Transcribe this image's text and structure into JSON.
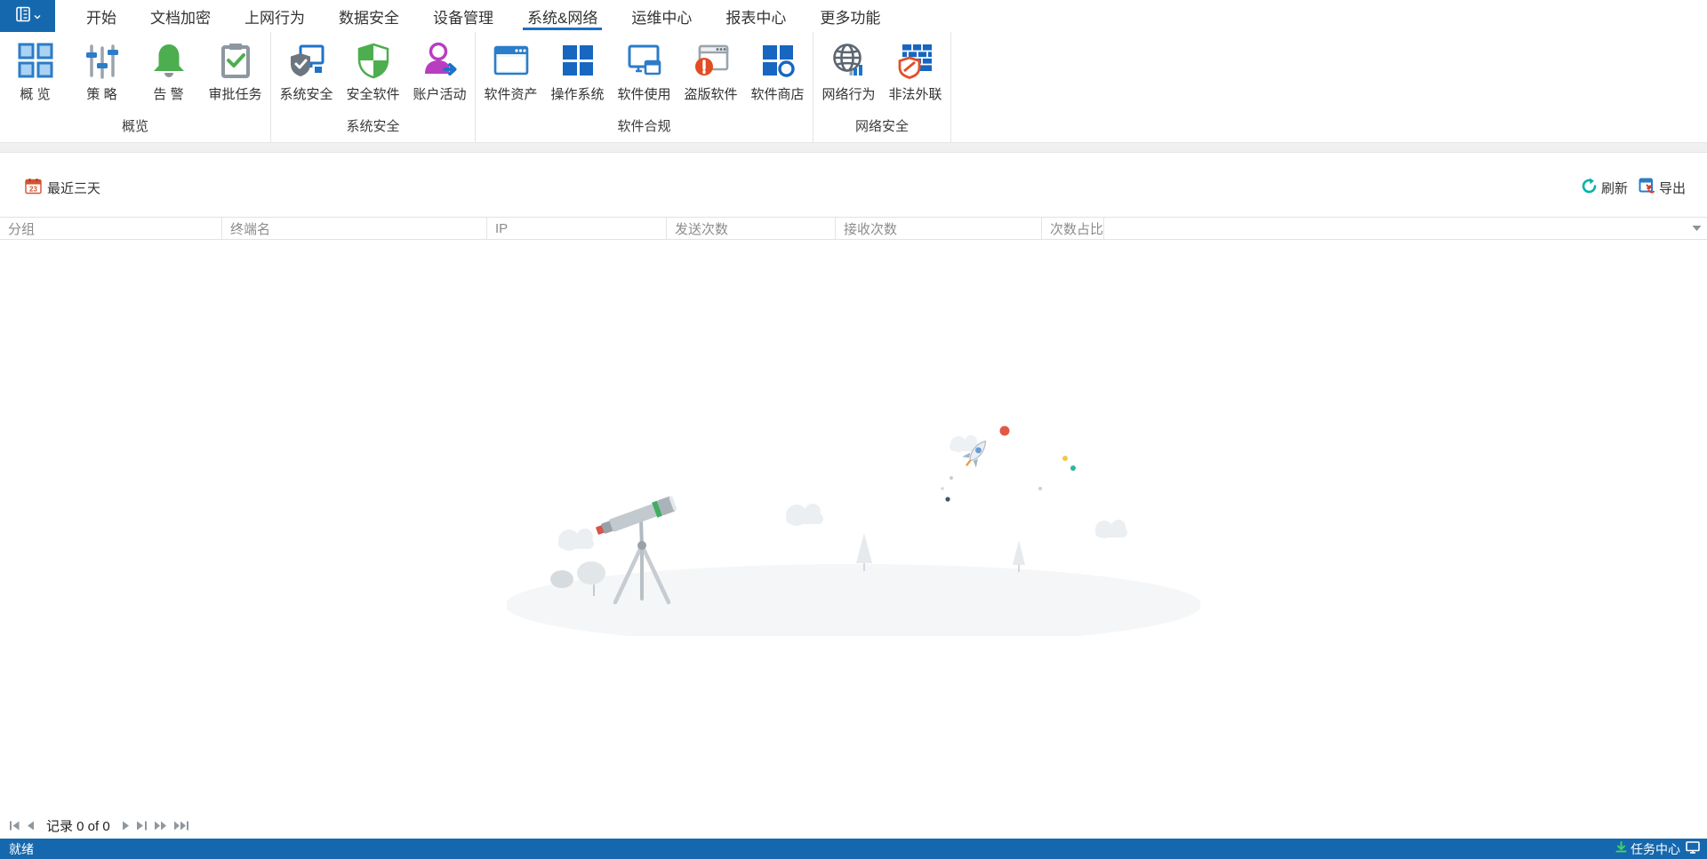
{
  "app": {
    "tabs": [
      {
        "label": "开始",
        "selected": false
      },
      {
        "label": "文档加密",
        "selected": false
      },
      {
        "label": "上网行为",
        "selected": false
      },
      {
        "label": "数据安全",
        "selected": false
      },
      {
        "label": "设备管理",
        "selected": false
      },
      {
        "label": "系统&网络",
        "selected": true
      },
      {
        "label": "运维中心",
        "selected": false
      },
      {
        "label": "报表中心",
        "selected": false
      },
      {
        "label": "更多功能",
        "selected": false
      }
    ]
  },
  "ribbon": {
    "groups": [
      {
        "label": "概览",
        "items": [
          {
            "label": "概 览",
            "icon": "overview-grid-icon"
          },
          {
            "label": "策 略",
            "icon": "policy-sliders-icon"
          },
          {
            "label": "告 警",
            "icon": "alert-bell-icon"
          },
          {
            "label": "审批任务",
            "icon": "approval-clipboard-icon"
          }
        ]
      },
      {
        "label": "系统安全",
        "items": [
          {
            "label": "系统安全",
            "icon": "system-security-icon"
          },
          {
            "label": "安全软件",
            "icon": "security-software-icon"
          },
          {
            "label": "账户活动",
            "icon": "account-activity-icon"
          }
        ]
      },
      {
        "label": "软件合规",
        "items": [
          {
            "label": "软件资产",
            "icon": "software-asset-icon"
          },
          {
            "label": "操作系统",
            "icon": "os-windows-icon"
          },
          {
            "label": "软件使用",
            "icon": "software-usage-icon"
          },
          {
            "label": "盗版软件",
            "icon": "pirated-software-icon"
          },
          {
            "label": "软件商店",
            "icon": "software-store-icon"
          }
        ]
      },
      {
        "label": "网络安全",
        "items": [
          {
            "label": "网络行为",
            "icon": "network-behavior-icon"
          },
          {
            "label": "非法外联",
            "icon": "illegal-connection-icon"
          }
        ]
      }
    ]
  },
  "toolbar": {
    "date_filter": "最近三天",
    "calendar_day": "23",
    "refresh_label": "刷新",
    "export_label": "导出"
  },
  "table": {
    "columns": [
      "分组",
      "终端名",
      "IP",
      "发送次数",
      "接收次数",
      "次数占比"
    ]
  },
  "pager": {
    "record_text": "记录 0 of 0"
  },
  "statusbar": {
    "ready": "就绪",
    "task_center": "任务中心"
  },
  "colors": {
    "brand_blue": "#1568ae",
    "tab_underline": "#1b6fc8",
    "icon_blue": "#2b7cc9",
    "solid_blue": "#1766c0",
    "green": "#4cae4f",
    "teal_refresh": "#00b3a6",
    "alert_red_orange": "#e34b22",
    "magenta": "#b83ec0",
    "header_text": "#8c8c8c"
  }
}
